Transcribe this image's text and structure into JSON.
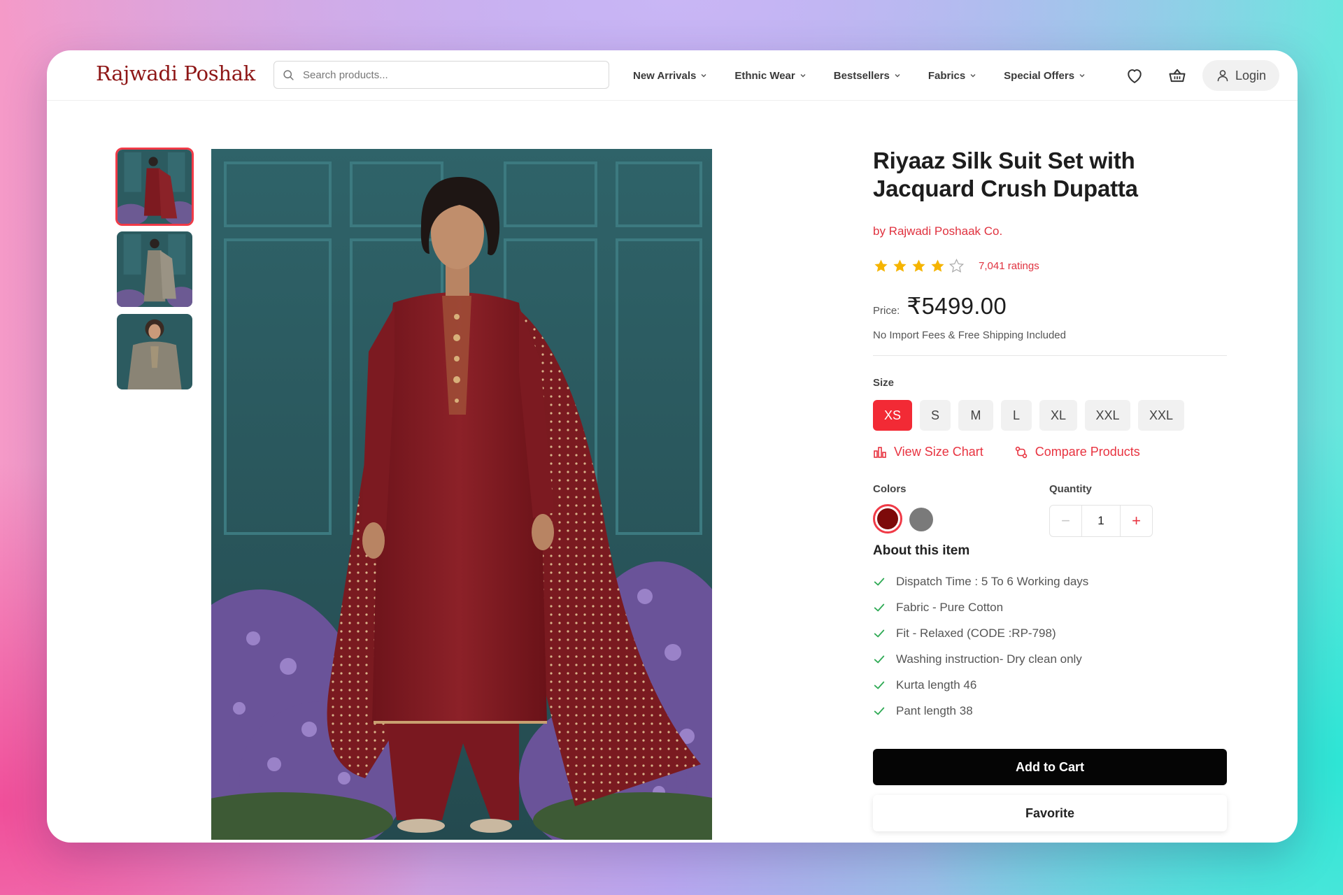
{
  "header": {
    "logo": "Rajwadi Poshak",
    "search_placeholder": "Search products...",
    "nav": [
      "New Arrivals",
      "Ethnic Wear",
      "Bestsellers",
      "Fabrics",
      "Special Offers"
    ],
    "login_label": "Login",
    "icons": [
      "search-icon",
      "chevron-down-icon",
      "heart-icon",
      "basket-icon",
      "user-icon"
    ]
  },
  "gallery": {
    "thumbnails": [
      "maroon suit full length",
      "grey suit full length",
      "grey suit close-up"
    ],
    "active_thumbnail": 0
  },
  "product": {
    "title": "Riyaaz Silk Suit Set with Jacquard Crush Dupatta",
    "brand": "by Rajwadi Poshaak Co.",
    "rating": 4,
    "rating_max": 5,
    "ratings_count": "7,041 ratings",
    "price_label": "Price:",
    "price": "₹5499.00",
    "shipping_note": "No Import Fees & Free Shipping Included",
    "size_label": "Size",
    "sizes": [
      "XS",
      "S",
      "M",
      "L",
      "XL",
      "XXL",
      "XXL"
    ],
    "selected_size": "XS",
    "size_chart_label": "View Size Chart",
    "compare_label": "Compare Products",
    "colors_label": "Colors",
    "colors": [
      "#7d0a0a",
      "#7a7a7a"
    ],
    "selected_color": "#7d0a0a",
    "quantity_label": "Quantity",
    "quantity": "1",
    "quantity_minus": "−",
    "quantity_plus": "+",
    "about_title": "About this item",
    "features": [
      "Dispatch Time : 5 To 6 Working days",
      "Fabric - Pure Cotton",
      "Fit - Relaxed (CODE :RP-798)",
      "Washing instruction- Dry clean only",
      "Kurta length 46",
      "Pant length 38"
    ],
    "add_to_cart_label": "Add to Cart",
    "favorite_label": "Favorite"
  },
  "colors": {
    "accent": "#f22a35",
    "brand_red": "#8e1616",
    "star": "#f5b400",
    "check": "#2faa55"
  }
}
